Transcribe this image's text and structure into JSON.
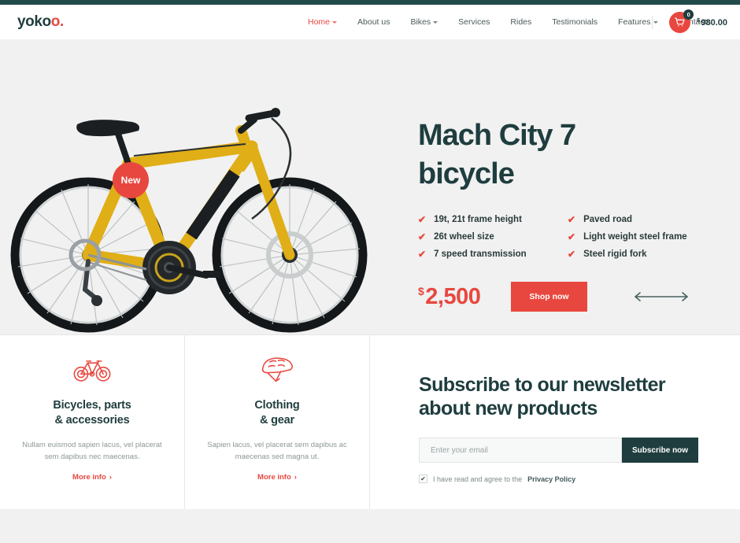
{
  "colors": {
    "accent_red": "#e8473f",
    "dark_teal": "#1f3d3e",
    "page_bg": "#f0f1f0",
    "bike_yellow": "#e8b41c"
  },
  "header": {
    "logo_main": "yoko",
    "logo_accent": "o.",
    "nav": [
      {
        "label": "Home",
        "active": true,
        "has_caret": true
      },
      {
        "label": "About us",
        "active": false,
        "has_caret": false
      },
      {
        "label": "Bikes",
        "active": false,
        "has_caret": true
      },
      {
        "label": "Services",
        "active": false,
        "has_caret": false
      },
      {
        "label": "Rides",
        "active": false,
        "has_caret": false
      },
      {
        "label": "Testimonials",
        "active": false,
        "has_caret": false
      },
      {
        "label": "Features",
        "active": false,
        "has_caret": true
      },
      {
        "label": "Contacts",
        "active": false,
        "has_caret": false
      }
    ],
    "cart": {
      "badge_count": "0",
      "currency": "$",
      "total": "980.00"
    }
  },
  "hero": {
    "badge": "New",
    "title_line1": "Mach City 7",
    "title_line2": "bicycle",
    "features_left": [
      "19t, 21t frame height",
      "26t wheel size",
      "7 speed transmission"
    ],
    "features_right": [
      "Paved road",
      "Light weight steel frame",
      "Steel rigid fork"
    ],
    "check_glyph": "✔",
    "price_currency": "$",
    "price": "2,500",
    "cta": "Shop now"
  },
  "cards": [
    {
      "icon": "bicycle-icon",
      "title_line1": "Bicycles, parts",
      "title_line2": "& accessories",
      "desc": "Nullam euismod sapien lacus, vel placerat sem dapibus nec maecenas.",
      "link": "More info",
      "link_chevron": "›"
    },
    {
      "icon": "helmet-icon",
      "title_line1": "Clothing",
      "title_line2": "& gear",
      "desc": "Sapien lacus, vel placerat sem dapibus ac maecenas sed magna ut.",
      "link": "More info",
      "link_chevron": "›"
    }
  ],
  "newsletter": {
    "title_line1": "Subscribe to our newsletter",
    "title_line2": "about new products",
    "email_placeholder": "Enter your email",
    "email_value": "",
    "submit": "Subscribe now",
    "consent_prefix": "I have read and agree to the",
    "consent_link": "Privacy Policy",
    "checkbox_checked": true,
    "check_glyph": "✔"
  }
}
